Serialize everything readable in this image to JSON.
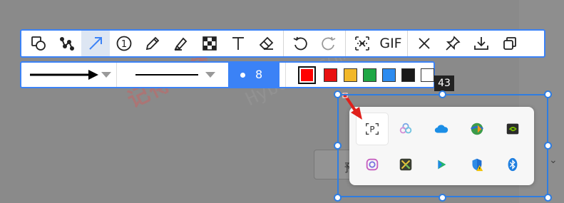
{
  "toolbar": {
    "tools": [
      {
        "icon": "shape-icon"
      },
      {
        "icon": "polyline-icon"
      },
      {
        "icon": "arrow-tool-icon",
        "active": true
      },
      {
        "icon": "number-marker-icon",
        "label": "1"
      },
      {
        "icon": "pen-icon"
      },
      {
        "icon": "highlighter-icon"
      },
      {
        "icon": "mosaic-icon"
      },
      {
        "icon": "text-tool-icon"
      },
      {
        "icon": "eraser-icon"
      },
      {
        "icon": "undo-icon"
      },
      {
        "icon": "redo-icon"
      },
      {
        "icon": "scroll-capture-icon"
      },
      {
        "icon": "gif-icon",
        "label": "GIF"
      },
      {
        "icon": "close-icon"
      },
      {
        "icon": "pin-icon"
      },
      {
        "icon": "download-icon"
      },
      {
        "icon": "copy-icon"
      }
    ]
  },
  "options": {
    "arrow_style": "arrow-line",
    "line_style": "solid-line",
    "size": "8",
    "colors": [
      "#ff0000",
      "#e81010",
      "#f2b829",
      "#1fa745",
      "#2d8cf0",
      "#1a1a1a",
      "#ffffff"
    ],
    "selected_color": "#ff0000",
    "accent": "#3b82f6"
  },
  "selection": {
    "dimension_label": "43"
  },
  "tray": {
    "icons": [
      "input-method-icon",
      "color-circles-icon",
      "onedrive-cloud-icon",
      "download-manager-icon",
      "nvidia-icon",
      "camera-capture-icon",
      "translate-app-icon",
      "play-store-icon",
      "security-warning-icon",
      "bluetooth-icon"
    ]
  },
  "background": {
    "partial_field_char": "预",
    "watermark": "记得收藏",
    "watermark_site": "Hybase.com"
  }
}
